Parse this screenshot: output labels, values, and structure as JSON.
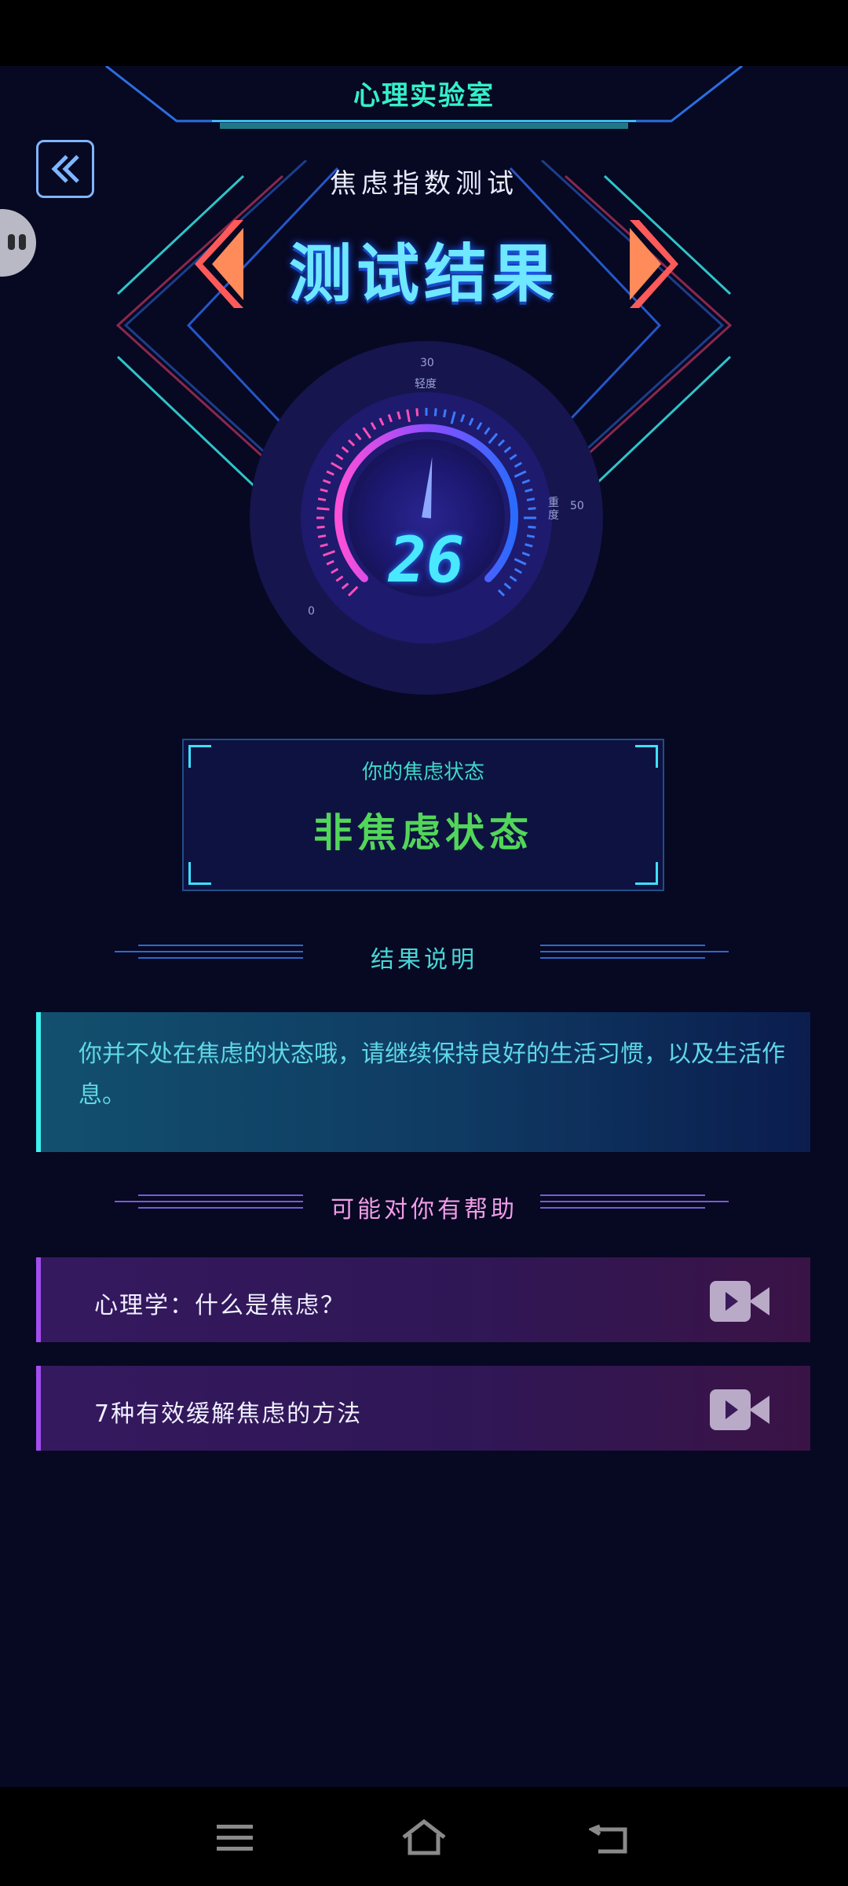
{
  "header": {
    "lab_title": "心理实验室",
    "test_name": "焦虑指数测试",
    "result_title": "测试结果",
    "back_icon": "double-chevron-left-icon",
    "prev_icon": "chevron-left-icon",
    "next_icon": "chevron-right-icon"
  },
  "gauge": {
    "value": "26",
    "score_fraction": 0.52,
    "label_top_num": "30",
    "label_top": "轻度",
    "label_right_num": "50",
    "label_right": "重度",
    "label_left_num": "0"
  },
  "status": {
    "label": "你的焦虑状态",
    "value": "非焦虑状态"
  },
  "result_section": {
    "title": "结果说明",
    "text": "你并不处在焦虑的状态哦，请继续保持良好的生活习惯，以及生活作息。"
  },
  "help_section": {
    "title": "可能对你有帮助",
    "items": [
      {
        "label": "心理学：什么是焦虑？",
        "icon": "video-camera-icon"
      },
      {
        "label": "7种有效缓解焦虑的方法",
        "icon": "video-camera-icon"
      }
    ]
  },
  "navigation": {
    "menu_icon": "menu-icon",
    "home_icon": "home-icon",
    "back_icon": "back-arrow-icon"
  },
  "colors": {
    "accent_cyan": "#3ee0ff",
    "status_green": "#52d65a",
    "help_purple": "#a34df0",
    "arrow_red": "#ff5a5a"
  }
}
